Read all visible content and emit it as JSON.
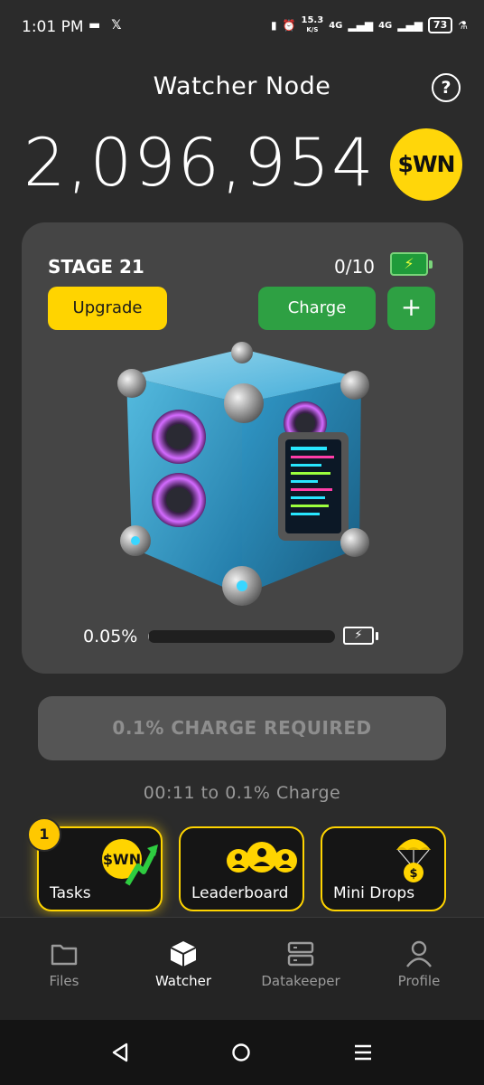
{
  "status_bar": {
    "time": "1:01 PM",
    "net_speed_top": "15.3",
    "net_speed_unit": "K/S",
    "network_1": "4G",
    "network_2": "4G",
    "battery": "73"
  },
  "header": {
    "title": "Watcher Node",
    "help_icon": "question-circle-icon"
  },
  "balance": {
    "amount": "2,096,954",
    "token": "$WN"
  },
  "stage": {
    "title": "STAGE 21",
    "charges": "0/10",
    "upgrade_label": "Upgrade",
    "charge_label": "Charge",
    "plus_label": "+",
    "progress_label": "0.05%",
    "progress_fraction": 0.0005
  },
  "charge_required": {
    "label": "0.1% CHARGE REQUIRED",
    "timer_text": "00:11  to 0.1% Charge"
  },
  "features": [
    {
      "label": "Tasks",
      "badge": "1",
      "icon": "wn-coin-arrow-icon"
    },
    {
      "label": "Leaderboard",
      "icon": "group-icon"
    },
    {
      "label": "Mini Drops",
      "icon": "parachute-coin-icon"
    }
  ],
  "nav": [
    {
      "label": "Files",
      "icon": "folder-icon",
      "active": false
    },
    {
      "label": "Watcher",
      "icon": "cube-icon",
      "active": true
    },
    {
      "label": "Datakeeper",
      "icon": "server-icon",
      "active": false
    },
    {
      "label": "Profile",
      "icon": "user-icon",
      "active": false
    }
  ],
  "colors": {
    "accent_yellow": "#ffd400",
    "accent_green": "#2ea043",
    "background": "#2b2b2b",
    "card": "#454545"
  }
}
